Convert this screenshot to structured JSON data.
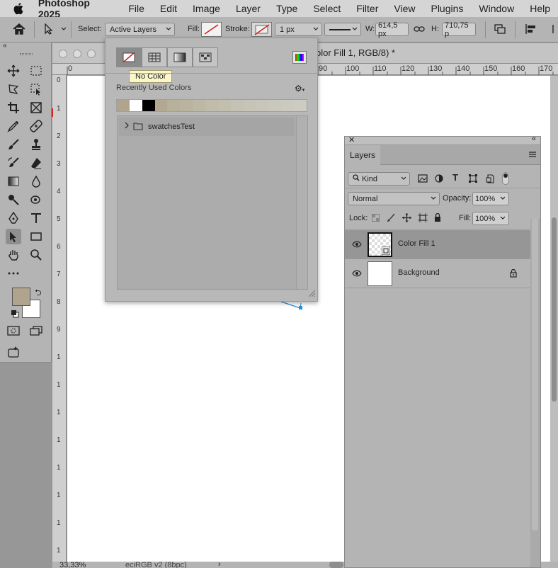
{
  "menubar": {
    "app_name": "Photoshop 2025",
    "items": [
      "File",
      "Edit",
      "Image",
      "Layer",
      "Type",
      "Select",
      "Filter",
      "View",
      "Plugins",
      "Window",
      "Help"
    ]
  },
  "options_bar": {
    "select_label": "Select:",
    "select_value": "Active Layers",
    "fill_label": "Fill:",
    "stroke_label": "Stroke:",
    "stroke_width": "1 px",
    "w_label": "W:",
    "w_value": "614,5 px",
    "h_label": "H:",
    "h_value": "710,75 p"
  },
  "document": {
    "tab_title": "olor Fill 1, RGB/8) *",
    "ruler_top_labels": [
      "0",
      "90",
      "100",
      "110",
      "120",
      "130",
      "140",
      "150",
      "160",
      "170"
    ],
    "ruler_left_labels": [
      "0",
      "1",
      "2",
      "3",
      "4",
      "5",
      "6",
      "7",
      "8",
      "9",
      "1",
      "1",
      "1",
      "1",
      "1",
      "1",
      "1",
      "1",
      "1",
      "1"
    ],
    "zoom": "33,33%",
    "color_profile": "eciRGB v2 (8bpc)"
  },
  "swatch_popup": {
    "tooltip": "No Color",
    "recent_label": "Recently Used Colors",
    "recent_colors": [
      "#b0a48e",
      "#ffffff",
      "#000000",
      "#b3a992",
      "#b7b09a",
      "#bab39e",
      "#bdb8a5",
      "#c0bcab",
      "#c2bfaf",
      "#c4c2b4",
      "#c6c4b7",
      "#c8c6ba",
      "#cac8bd",
      "#cbcac0",
      "#cdcbc3"
    ],
    "group_name": "swatchesTest"
  },
  "toolbox": {
    "foreground_color": "#b0a48e",
    "background_color": "#ffffff"
  },
  "layers_panel": {
    "tab_label": "Layers",
    "filter_kind": "Kind",
    "blend_mode": "Normal",
    "opacity_label": "Opacity:",
    "opacity_value": "100%",
    "lock_label": "Lock:",
    "fill_label": "Fill:",
    "fill_value": "100%",
    "layers": [
      {
        "name": "Color Fill 1",
        "selected": true
      },
      {
        "name": "Background",
        "selected": false
      }
    ]
  }
}
